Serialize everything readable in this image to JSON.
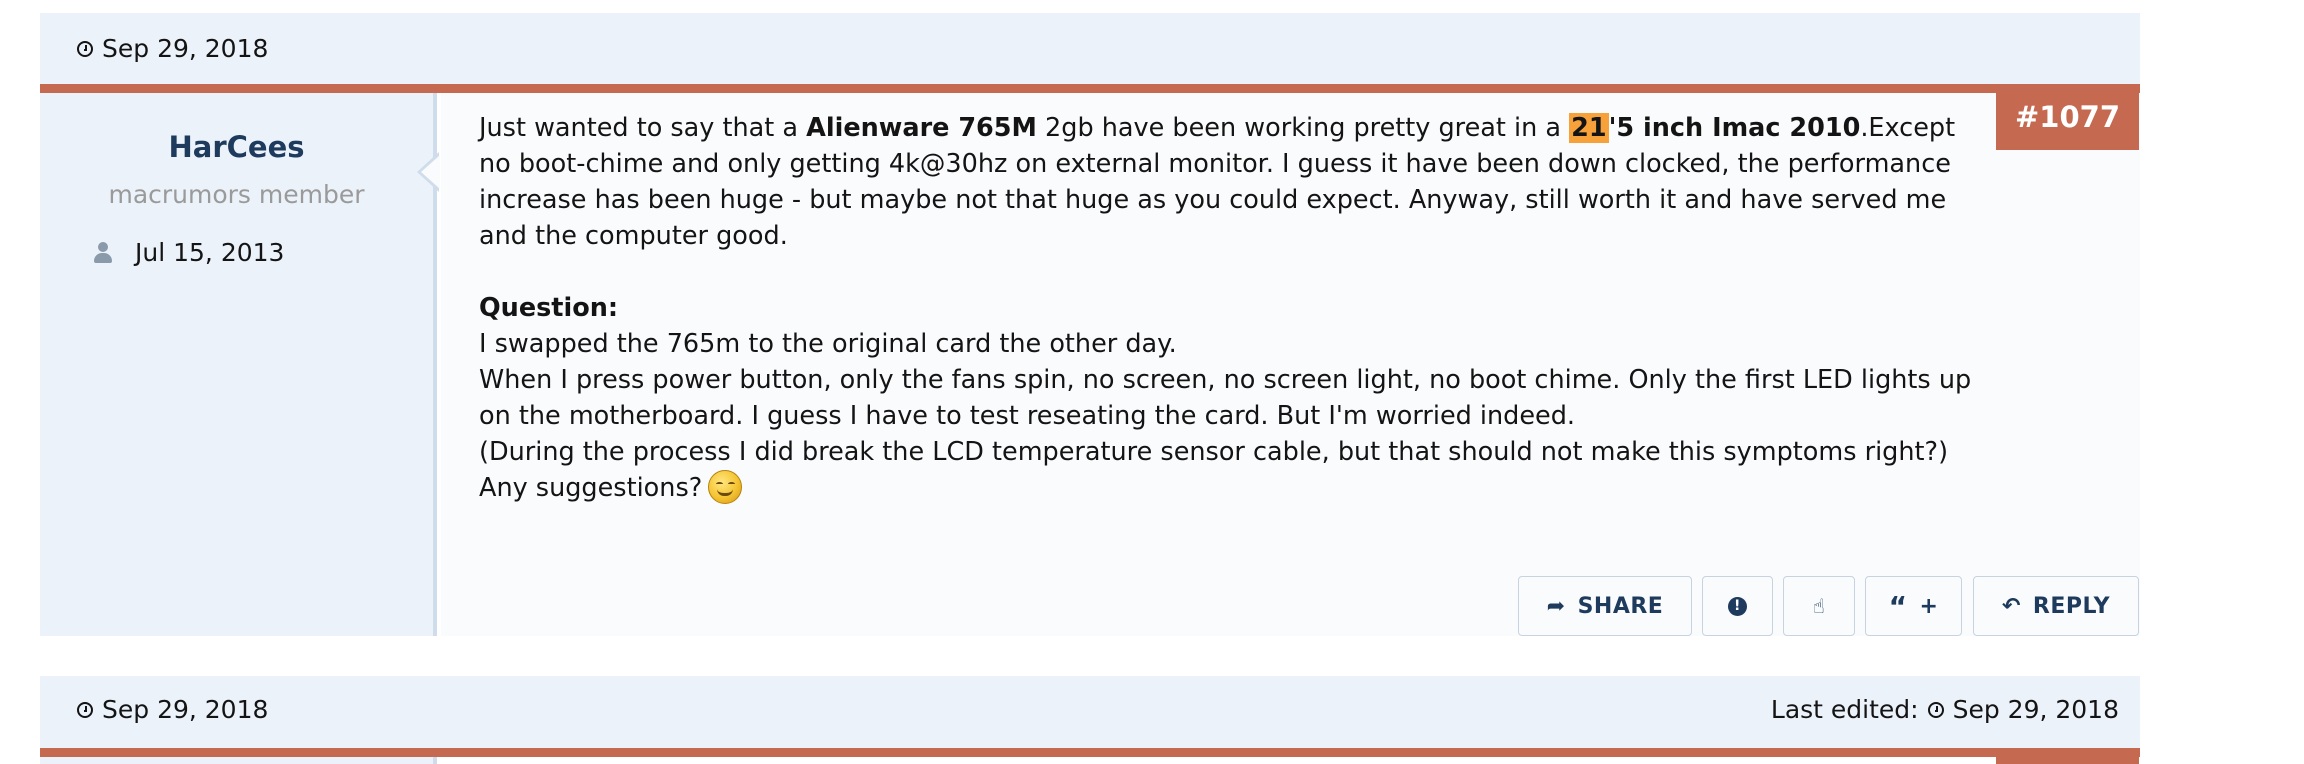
{
  "post_top": {
    "date": "Sep 29, 2018"
  },
  "user": {
    "name": "HarCees",
    "title": "macrumors member",
    "joined": "Jul 15, 2013"
  },
  "post": {
    "number": "#1077",
    "p1": {
      "t1": "Just wanted to say that a ",
      "b1": "Alienware 765M",
      "t2": " 2gb have been working pretty great in a ",
      "hl": "21",
      "b2": "'5 inch Imac 2010",
      "t3": ".Except no boot-chime and only getting 4k@30hz on external monitor. I guess it have been down clocked, the performance increase has been huge - but maybe not that huge as you could expect. Anyway, still worth it and have served me and the computer good."
    },
    "question_label": "Question:",
    "lines": [
      "I swapped the 765m to the original card the other day.",
      "When I press power button, only the fans spin, no screen, no screen light, no boot chime. Only the first LED lights up on the motherboard. I guess I have to test reseating the card. But I'm worried indeed.",
      "(During the process I did break the LCD temperature sensor cable, but that should not make this symptoms right?)",
      "Any suggestions?"
    ]
  },
  "actions": {
    "share": "SHARE",
    "reply": "REPLY",
    "quote_plus": "+"
  },
  "next_post": {
    "date": "Sep 29, 2018",
    "last_edited_label": "Last edited:",
    "last_edited_date": "Sep 29, 2018"
  },
  "colors": {
    "accent": "#c56a51",
    "bar_bg": "#ebf2fa",
    "highlight": "#f6a13a",
    "link": "#1e3a5c"
  },
  "icons": [
    "clock-icon",
    "user-icon",
    "share-icon",
    "report-icon",
    "like-icon",
    "quote-icon",
    "reply-icon",
    "smiley-icon"
  ]
}
